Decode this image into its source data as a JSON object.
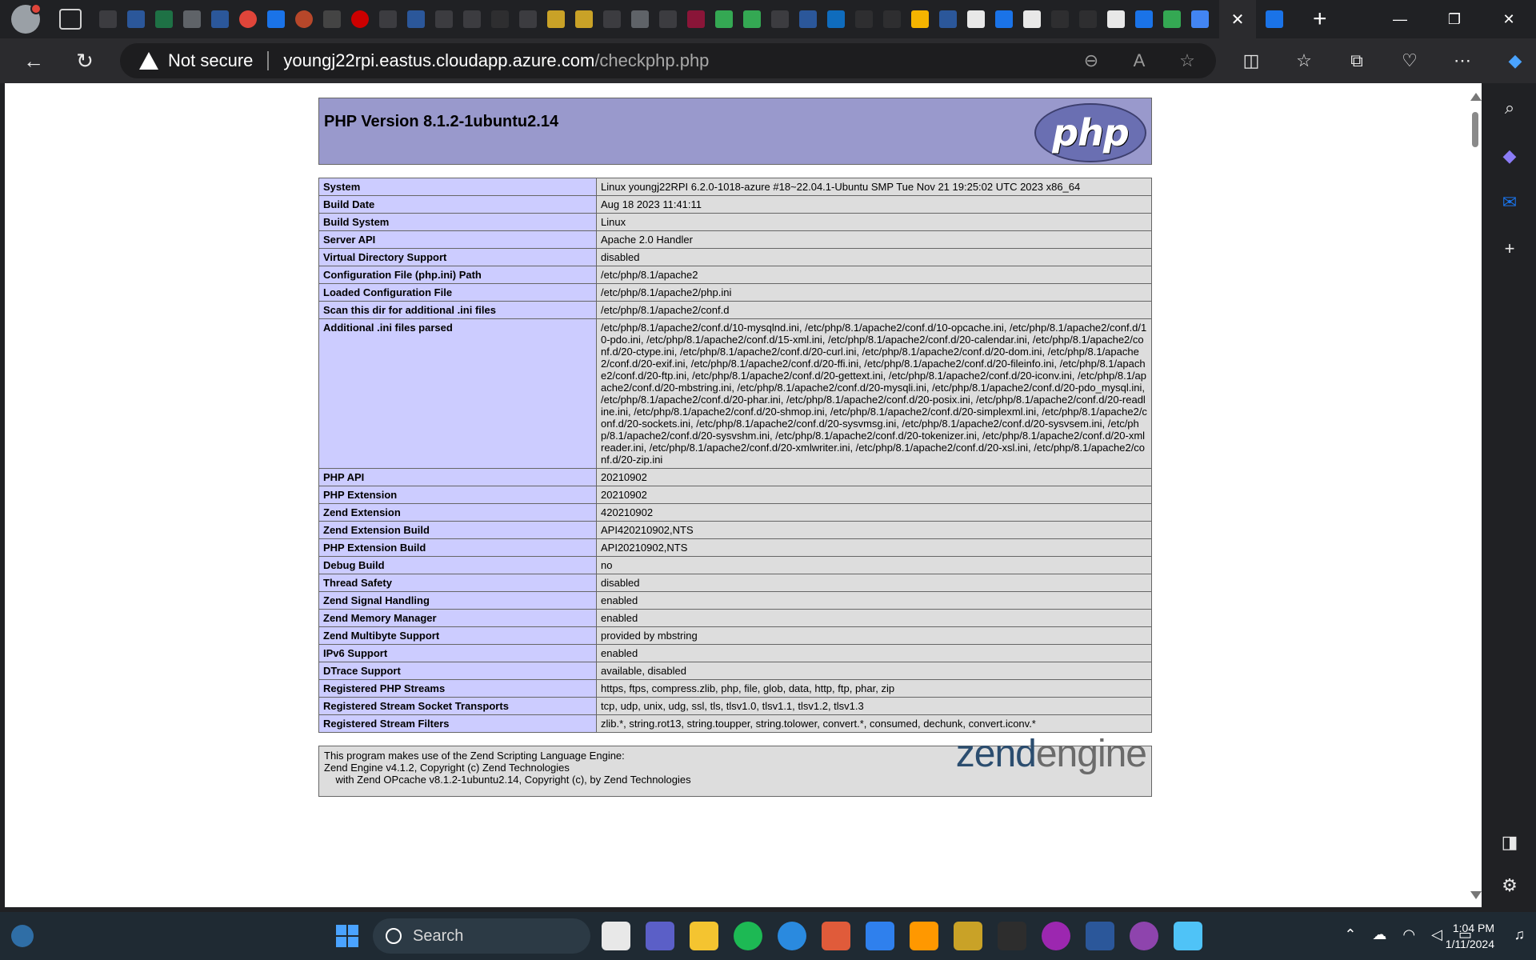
{
  "browser": {
    "security_label": "Not secure",
    "url_host": "youngj22rpi.eastus.cloudapp.azure.com",
    "url_path": "/checkphp.php",
    "tab_close": "✕",
    "new_tab": "+"
  },
  "page": {
    "title": "PHP Version 8.1.2-1ubuntu2.14",
    "logo_text": "php",
    "rows": [
      {
        "key": "System",
        "value": "Linux youngj22RPI 6.2.0-1018-azure #18~22.04.1-Ubuntu SMP Tue Nov 21 19:25:02 UTC 2023 x86_64"
      },
      {
        "key": "Build Date",
        "value": "Aug 18 2023 11:41:11"
      },
      {
        "key": "Build System",
        "value": "Linux"
      },
      {
        "key": "Server API",
        "value": "Apache 2.0 Handler"
      },
      {
        "key": "Virtual Directory Support",
        "value": "disabled"
      },
      {
        "key": "Configuration File (php.ini) Path",
        "value": "/etc/php/8.1/apache2"
      },
      {
        "key": "Loaded Configuration File",
        "value": "/etc/php/8.1/apache2/php.ini"
      },
      {
        "key": "Scan this dir for additional .ini files",
        "value": "/etc/php/8.1/apache2/conf.d"
      },
      {
        "key": "Additional .ini files parsed",
        "value": "/etc/php/8.1/apache2/conf.d/10-mysqlnd.ini, /etc/php/8.1/apache2/conf.d/10-opcache.ini, /etc/php/8.1/apache2/conf.d/10-pdo.ini, /etc/php/8.1/apache2/conf.d/15-xml.ini, /etc/php/8.1/apache2/conf.d/20-calendar.ini, /etc/php/8.1/apache2/conf.d/20-ctype.ini, /etc/php/8.1/apache2/conf.d/20-curl.ini, /etc/php/8.1/apache2/conf.d/20-dom.ini, /etc/php/8.1/apache2/conf.d/20-exif.ini, /etc/php/8.1/apache2/conf.d/20-ffi.ini, /etc/php/8.1/apache2/conf.d/20-fileinfo.ini, /etc/php/8.1/apache2/conf.d/20-ftp.ini, /etc/php/8.1/apache2/conf.d/20-gettext.ini, /etc/php/8.1/apache2/conf.d/20-iconv.ini, /etc/php/8.1/apache2/conf.d/20-mbstring.ini, /etc/php/8.1/apache2/conf.d/20-mysqli.ini, /etc/php/8.1/apache2/conf.d/20-pdo_mysql.ini, /etc/php/8.1/apache2/conf.d/20-phar.ini, /etc/php/8.1/apache2/conf.d/20-posix.ini, /etc/php/8.1/apache2/conf.d/20-readline.ini, /etc/php/8.1/apache2/conf.d/20-shmop.ini, /etc/php/8.1/apache2/conf.d/20-simplexml.ini, /etc/php/8.1/apache2/conf.d/20-sockets.ini, /etc/php/8.1/apache2/conf.d/20-sysvmsg.ini, /etc/php/8.1/apache2/conf.d/20-sysvsem.ini, /etc/php/8.1/apache2/conf.d/20-sysvshm.ini, /etc/php/8.1/apache2/conf.d/20-tokenizer.ini, /etc/php/8.1/apache2/conf.d/20-xmlreader.ini, /etc/php/8.1/apache2/conf.d/20-xmlwriter.ini, /etc/php/8.1/apache2/conf.d/20-xsl.ini, /etc/php/8.1/apache2/conf.d/20-zip.ini"
      },
      {
        "key": "PHP API",
        "value": "20210902"
      },
      {
        "key": "PHP Extension",
        "value": "20210902"
      },
      {
        "key": "Zend Extension",
        "value": "420210902"
      },
      {
        "key": "Zend Extension Build",
        "value": "API420210902,NTS"
      },
      {
        "key": "PHP Extension Build",
        "value": "API20210902,NTS"
      },
      {
        "key": "Debug Build",
        "value": "no"
      },
      {
        "key": "Thread Safety",
        "value": "disabled"
      },
      {
        "key": "Zend Signal Handling",
        "value": "enabled"
      },
      {
        "key": "Zend Memory Manager",
        "value": "enabled"
      },
      {
        "key": "Zend Multibyte Support",
        "value": "provided by mbstring"
      },
      {
        "key": "IPv6 Support",
        "value": "enabled"
      },
      {
        "key": "DTrace Support",
        "value": "available, disabled"
      },
      {
        "key": "Registered PHP Streams",
        "value": "https, ftps, compress.zlib, php, file, glob, data, http, ftp, phar, zip"
      },
      {
        "key": "Registered Stream Socket Transports",
        "value": "tcp, udp, unix, udg, ssl, tls, tlsv1.0, tlsv1.1, tlsv1.2, tlsv1.3"
      },
      {
        "key": "Registered Stream Filters",
        "value": "zlib.*, string.rot13, string.toupper, string.tolower, convert.*, consumed, dechunk, convert.iconv.*"
      }
    ],
    "zend_lines": [
      "This program makes use of the Zend Scripting Language Engine:",
      "Zend Engine v4.1.2, Copyright (c) Zend Technologies",
      "    with Zend OPcache v8.1.2-1ubuntu2.14, Copyright (c), by Zend Technologies"
    ],
    "zend_logo_a": "zend",
    "zend_logo_b": "engine"
  },
  "taskbar": {
    "search_label": "Search",
    "time": "1:04 PM",
    "date": "1/11/2024"
  },
  "colors": {
    "header_bg": "#9999cc",
    "key_bg": "#ccccff",
    "value_bg": "#dddddd"
  },
  "icons": [
    "profile-icon",
    "tab-actions-icon",
    "back-icon",
    "refresh-icon",
    "warning-icon",
    "zoom-icon",
    "read-aloud-icon",
    "favorite-icon",
    "split-screen-icon",
    "favorites-icon",
    "collections-icon",
    "browser-essentials-icon",
    "more-icon",
    "copilot-icon",
    "search-icon",
    "outlook-icon",
    "add-icon",
    "settings-icon",
    "start-icon",
    "wifi-icon",
    "volume-icon",
    "battery-icon",
    "bell-icon"
  ]
}
